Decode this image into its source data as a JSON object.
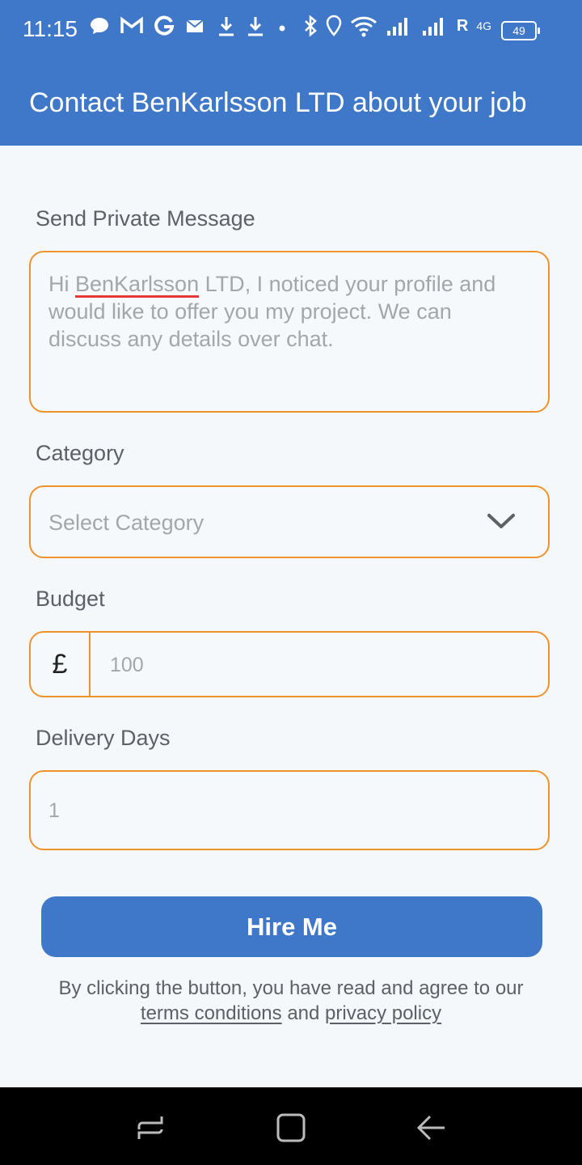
{
  "status": {
    "time": "11:15",
    "battery": "49",
    "network_label": "4G",
    "roaming": "R"
  },
  "appbar": {
    "title": "Contact BenKarlsson LTD about your job"
  },
  "message": {
    "label": "Send Private Message",
    "placeholder_prefix": "Hi ",
    "placeholder_name": "BenKarlsson",
    "placeholder_rest": " LTD, I noticed your profile and would like to offer you my project. We can discuss any details over chat."
  },
  "category": {
    "label": "Category",
    "placeholder": "Select Category"
  },
  "budget": {
    "label": "Budget",
    "currency_symbol": "£",
    "placeholder": "100"
  },
  "delivery": {
    "label": "Delivery Days",
    "placeholder": "1"
  },
  "hire_button": "Hire Me",
  "terms": {
    "prefix": "By clicking the button, you have read and agree to our",
    "terms_link": "terms conditions",
    "and": "and",
    "privacy_link": "privacy policy"
  },
  "colors": {
    "primary": "#3f78c8",
    "accent_border": "#f0922b",
    "background": "#f4f8fb"
  },
  "icons": [
    "chat-bubble-icon",
    "gmail-icon",
    "google-icon",
    "mail-icon",
    "download-icon",
    "download-icon",
    "dot-icon",
    "bluetooth-icon",
    "location-icon",
    "wifi-icon",
    "signal-icon",
    "signal-icon",
    "chevron-down-icon",
    "recents-icon",
    "home-icon",
    "back-icon"
  ]
}
